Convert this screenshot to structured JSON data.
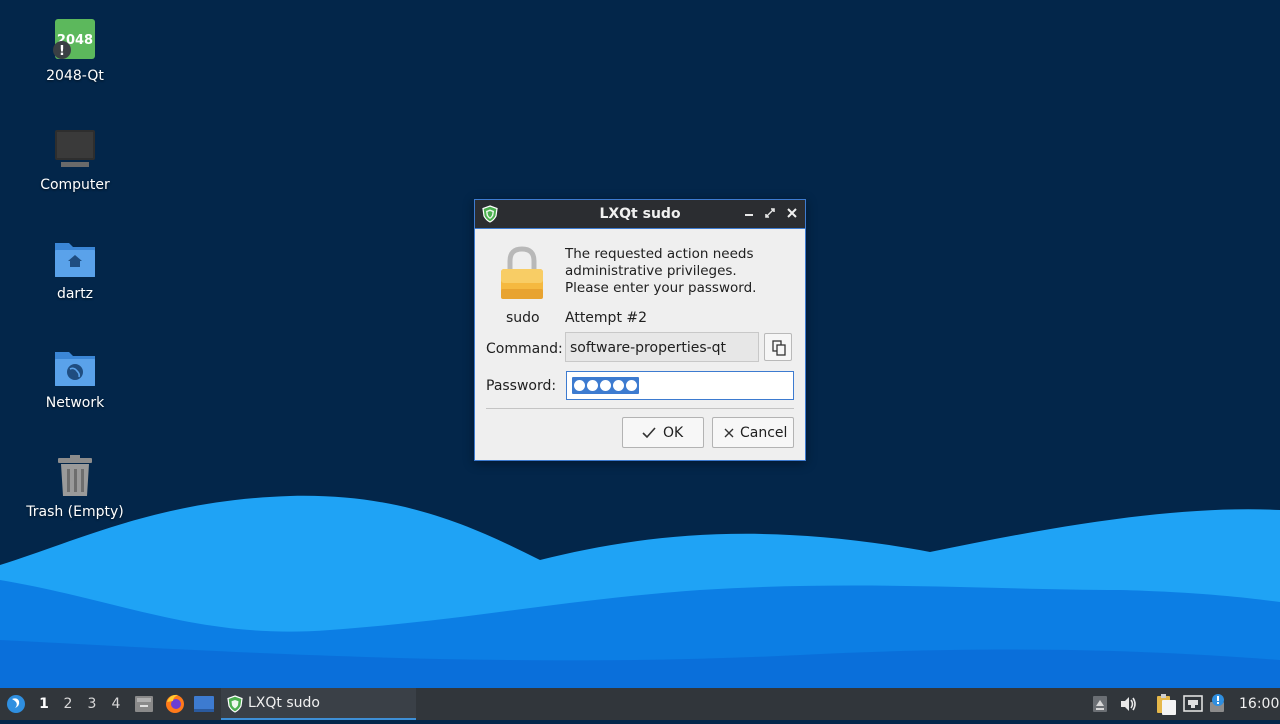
{
  "desktop": {
    "icons": [
      {
        "label": "2048-Qt",
        "icon": "2048-game-icon",
        "badge_text": "2048"
      },
      {
        "label": "Computer",
        "icon": "computer-icon"
      },
      {
        "label": "dartz",
        "icon": "home-folder-icon"
      },
      {
        "label": "Network",
        "icon": "network-folder-icon"
      },
      {
        "label": "Trash (Empty)",
        "icon": "trash-icon"
      }
    ]
  },
  "dialog": {
    "title": "LXQt sudo",
    "message": [
      "The requested action needs",
      "administrative privileges.",
      "Please enter your password."
    ],
    "sudo_label": "sudo",
    "attempt": "Attempt #2",
    "command_label": "Command:",
    "command_value": "software-properties-qt",
    "password_label": "Password:",
    "password_length": 5,
    "ok_label": "OK",
    "cancel_label": "Cancel"
  },
  "taskbar": {
    "desktops": [
      "1",
      "2",
      "3",
      "4"
    ],
    "active_desktop": "1",
    "task_label": "LXQt sudo",
    "clock": "16:00"
  },
  "colors": {
    "desktop_bg": "#03264a",
    "wave_light": "#1a9cf2",
    "wave_dark": "#0a6fd8",
    "accent": "#3d7bd0",
    "taskbar_bg": "#31363b"
  }
}
